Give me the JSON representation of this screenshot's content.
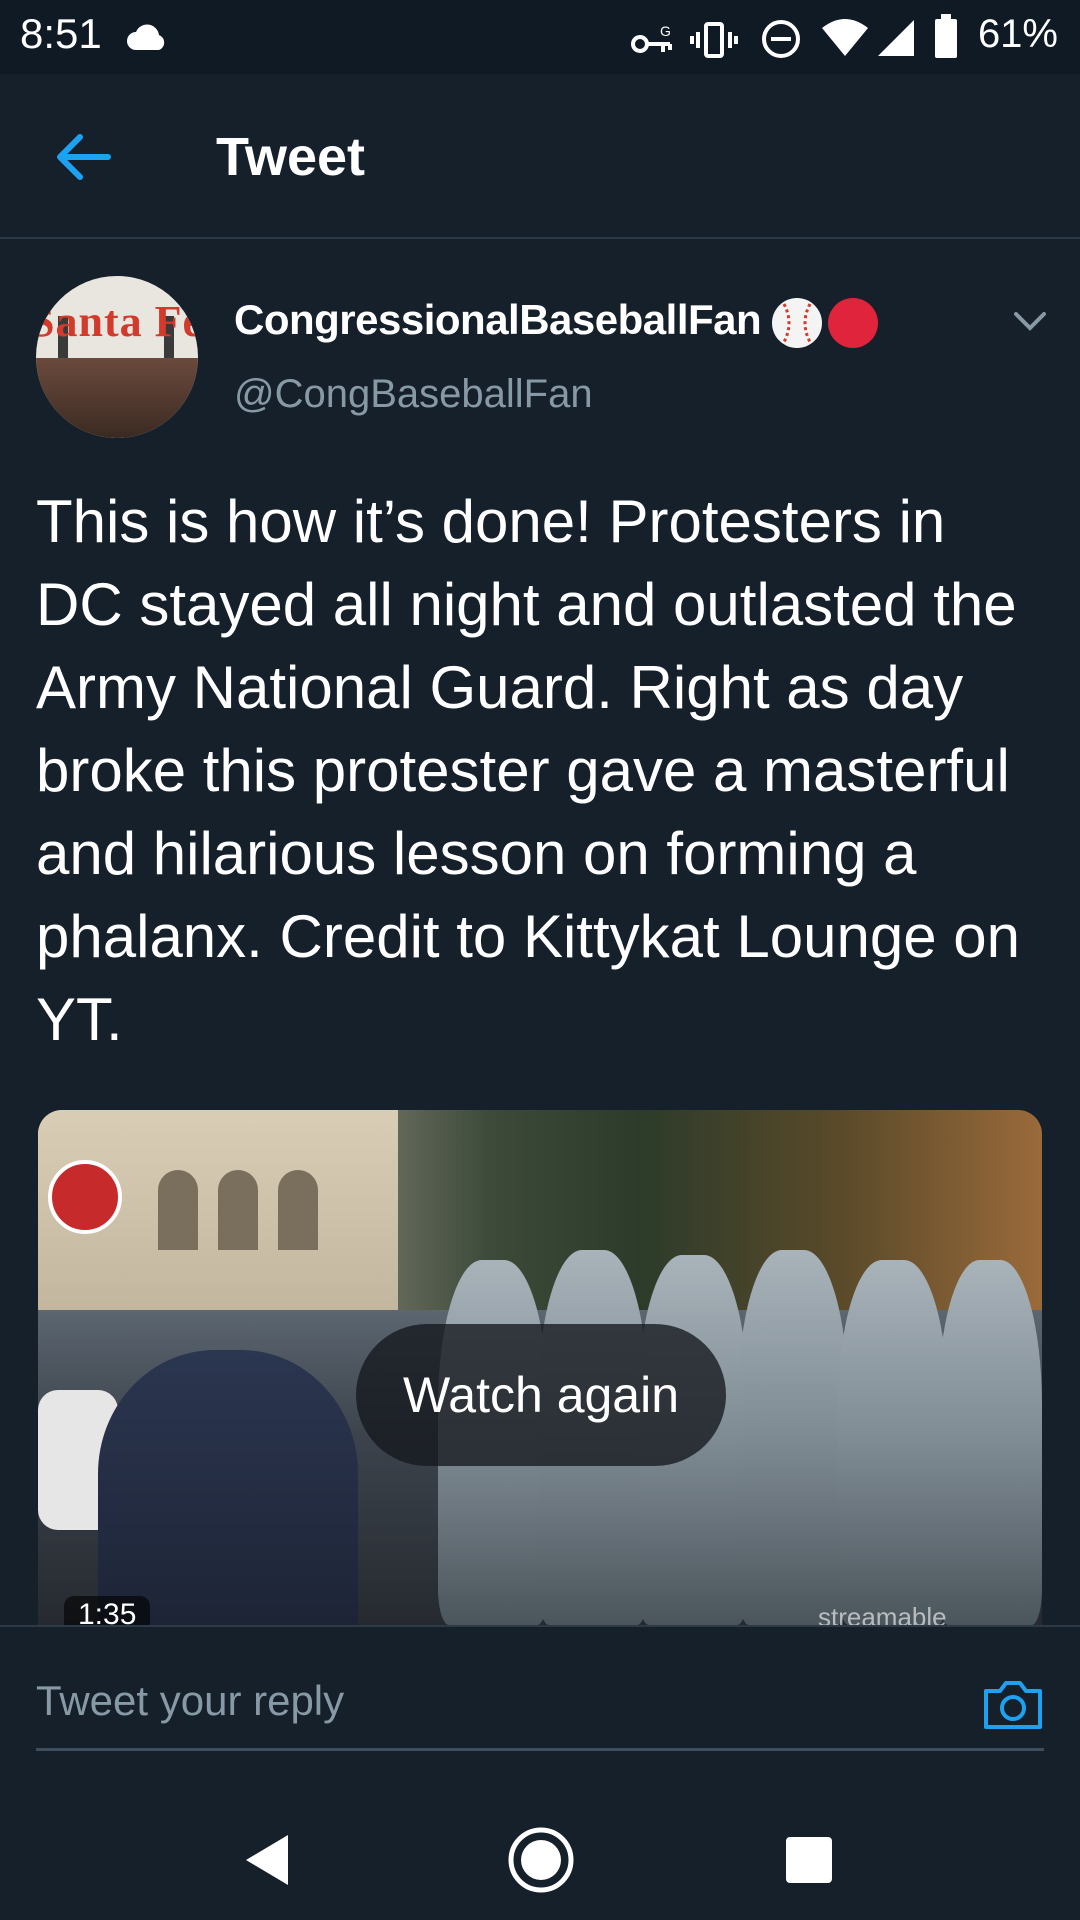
{
  "status_bar": {
    "time": "8:51",
    "battery_percent": "61%",
    "icons": [
      "cloud-icon",
      "vpn-key-icon",
      "vibrate-icon",
      "do-not-disturb-icon",
      "wifi-icon",
      "signal-icon",
      "battery-icon"
    ]
  },
  "app_bar": {
    "title": "Tweet",
    "back_icon": "back-arrow-icon"
  },
  "tweet": {
    "display_name": "CongressionalBaseballFan",
    "handle": "@CongBaseballFan",
    "avatar_sign_text": "Santa Fe",
    "text": "This is how it’s done! Protesters in DC stayed all night and outlasted the Army National Guard. Right as day broke this protester gave a masterful and hilarious lesson on forming a phalanx. Credit to Kittykat Lounge on YT.",
    "video": {
      "overlay_label": "Watch again",
      "duration": "1:35",
      "watermark": "streamable"
    }
  },
  "reply": {
    "placeholder": "Tweet your reply",
    "camera_icon": "camera-icon"
  },
  "nav": {
    "buttons": [
      "back-triangle-icon",
      "home-circle-icon",
      "recents-square-icon"
    ]
  },
  "colors": {
    "background": "#15202b",
    "accent": "#1da1f2",
    "secondary_text": "#8899a6",
    "divider": "#2c3a47"
  }
}
